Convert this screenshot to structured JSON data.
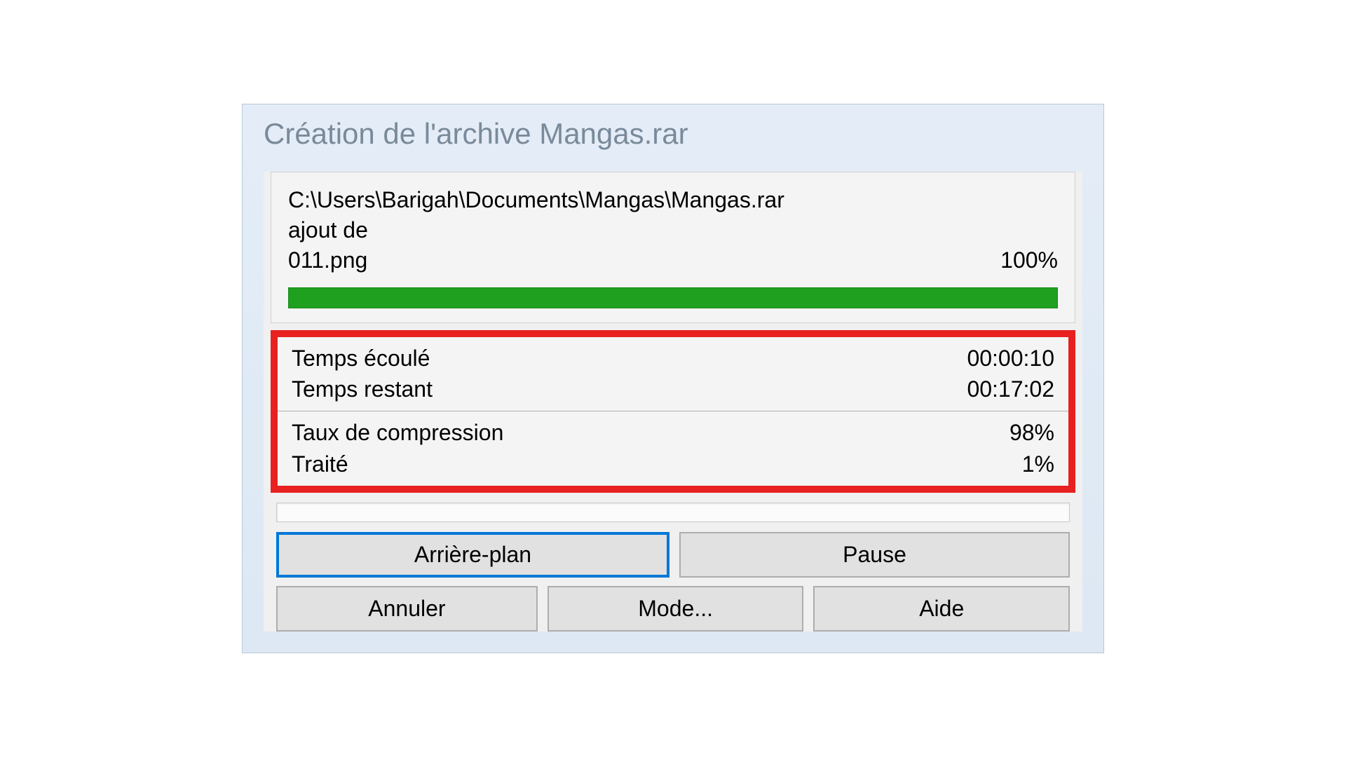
{
  "title": "Création de l'archive Mangas.rar",
  "file": {
    "path": "C:\\Users\\Barigah\\Documents\\Mangas\\Mangas.rar",
    "action": "ajout de",
    "current_file": "011.png",
    "file_percent": "100%"
  },
  "stats": {
    "elapsed_label": "Temps écoulé",
    "elapsed_value": "00:00:10",
    "remaining_label": "Temps restant",
    "remaining_value": "00:17:02",
    "compression_label": "Taux de compression",
    "compression_value": "98%",
    "processed_label": "Traité",
    "processed_value": "1%"
  },
  "buttons": {
    "background": "Arrière-plan",
    "pause": "Pause",
    "cancel": "Annuler",
    "mode": "Mode...",
    "help": "Aide"
  }
}
